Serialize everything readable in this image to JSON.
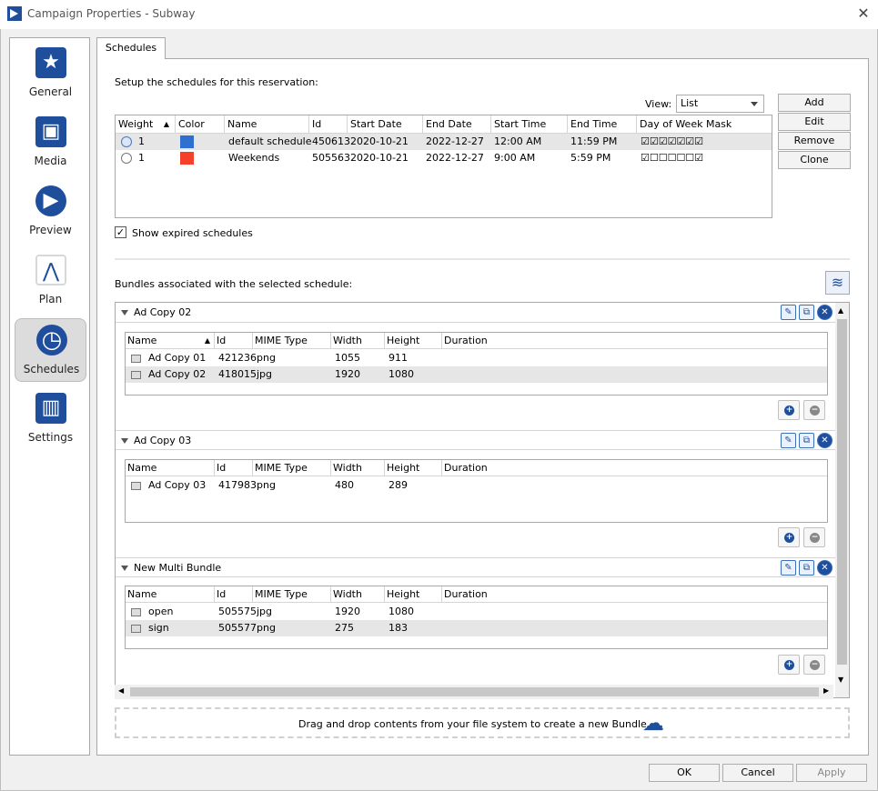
{
  "window": {
    "title": "Campaign Properties - Subway",
    "close_glyph": "✕"
  },
  "sidebar": {
    "items": [
      {
        "label": "General",
        "icon": "star-icon",
        "glyph": "★"
      },
      {
        "label": "Media",
        "icon": "media-icon",
        "glyph": "▣"
      },
      {
        "label": "Preview",
        "icon": "play-icon",
        "glyph": "▶"
      },
      {
        "label": "Plan",
        "icon": "compass-icon",
        "glyph": "⋀"
      },
      {
        "label": "Schedules",
        "icon": "clock-icon",
        "glyph": "◷"
      },
      {
        "label": "Settings",
        "icon": "settings-icon",
        "glyph": "▥"
      }
    ],
    "active": "Schedules"
  },
  "tab": {
    "label": "Schedules"
  },
  "schedules": {
    "intro": "Setup the schedules for this reservation:",
    "view_label": "View:",
    "view_value": "List",
    "buttons": {
      "add": "Add",
      "edit": "Edit",
      "remove": "Remove",
      "clone": "Clone"
    },
    "columns": [
      "Weight",
      "Color",
      "Name",
      "Id",
      "Start Date",
      "End Date",
      "Start Time",
      "End Time",
      "Day of Week Mask"
    ],
    "rows": [
      {
        "weight": "1",
        "color": "#2f6fd0",
        "name": "default schedule",
        "id": "450613",
        "start_date": "2020-10-21",
        "end_date": "2022-12-27",
        "start_time": "12:00 AM",
        "end_time": "11:59 PM",
        "mask": "☑☑☑☑☑☑☑"
      },
      {
        "weight": "1",
        "color": "#f5412a",
        "name": "Weekends",
        "id": "505563",
        "start_date": "2020-10-21",
        "end_date": "2022-12-27",
        "start_time": "9:00 AM",
        "end_time": "5:59 PM",
        "mask": "☑☐☐☐☐☐☑"
      }
    ],
    "show_expired_label": "Show expired schedules",
    "show_expired_checked": true,
    "show_expired_glyph": "✓"
  },
  "bundles": {
    "intro": "Bundles associated with the selected schedule:",
    "columns": [
      "Name",
      "Id",
      "MIME Type",
      "Width",
      "Height",
      "Duration"
    ],
    "items": [
      {
        "title": "Ad Copy 02",
        "files": [
          {
            "name": "Ad Copy 01",
            "id": "421236",
            "mime": "png",
            "width": "1055",
            "height": "911",
            "duration": ""
          },
          {
            "name": "Ad Copy 02",
            "id": "418015",
            "mime": "jpg",
            "width": "1920",
            "height": "1080",
            "duration": ""
          }
        ]
      },
      {
        "title": "Ad Copy 03",
        "files": [
          {
            "name": "Ad Copy 03",
            "id": "417983",
            "mime": "png",
            "width": "480",
            "height": "289",
            "duration": ""
          }
        ]
      },
      {
        "title": "New Multi Bundle",
        "files": [
          {
            "name": "open",
            "id": "505575",
            "mime": "jpg",
            "width": "1920",
            "height": "1080",
            "duration": ""
          },
          {
            "name": "sign",
            "id": "505577",
            "mime": "png",
            "width": "275",
            "height": "183",
            "duration": ""
          }
        ]
      }
    ],
    "dropzone": "Drag and drop contents from your file system to create a new Bundle"
  },
  "footer": {
    "ok": "OK",
    "cancel": "Cancel",
    "apply": "Apply"
  },
  "colors": {
    "accent": "#1f4e9c",
    "selection": "#e6e6e6"
  }
}
